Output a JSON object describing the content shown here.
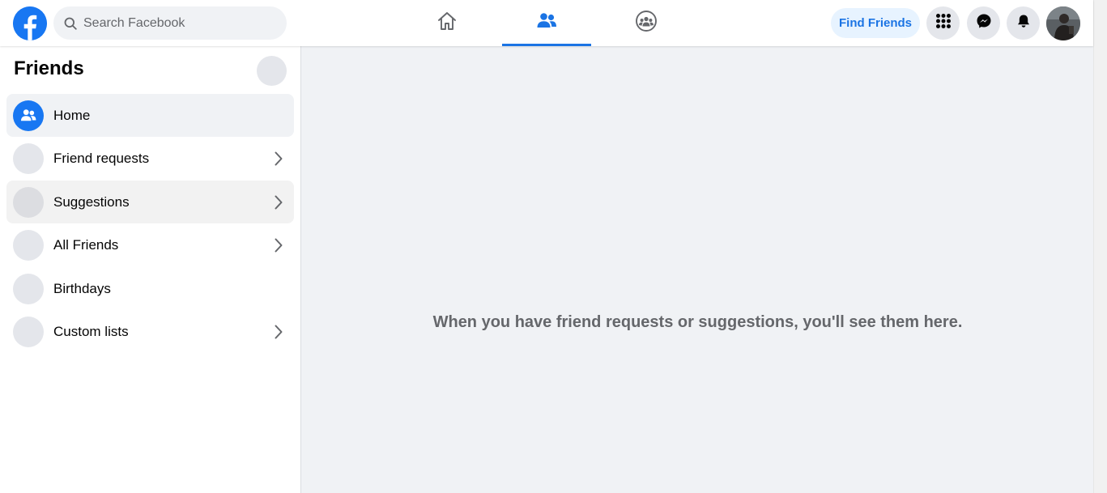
{
  "header": {
    "logo_icon": "facebook-logo",
    "search": {
      "placeholder": "Search Facebook",
      "icon": "search-icon"
    },
    "tabs": [
      {
        "name": "home",
        "icon": "home-icon",
        "active": false
      },
      {
        "name": "friends",
        "icon": "friends-icon",
        "active": true
      },
      {
        "name": "groups",
        "icon": "groups-icon",
        "active": false
      }
    ],
    "find_friends_label": "Find Friends",
    "menu_icon": "grid-menu-icon",
    "messenger_icon": "messenger-icon",
    "notifications_icon": "bell-icon"
  },
  "sidebar": {
    "title": "Friends",
    "items": [
      {
        "label": "Home",
        "icon": "friends-icon",
        "active": true,
        "chevron": false
      },
      {
        "label": "Friend requests",
        "icon": "friend-requests-icon",
        "active": false,
        "chevron": true
      },
      {
        "label": "Suggestions",
        "icon": "suggestions-icon",
        "active": false,
        "chevron": true
      },
      {
        "label": "All Friends",
        "icon": "all-friends-icon",
        "active": false,
        "chevron": true
      },
      {
        "label": "Birthdays",
        "icon": "birthdays-icon",
        "active": false,
        "chevron": false
      },
      {
        "label": "Custom lists",
        "icon": "custom-lists-icon",
        "active": false,
        "chevron": true
      }
    ]
  },
  "main": {
    "empty_message": "When you have friend requests or suggestions, you'll see them here."
  },
  "colors": {
    "brand": "#1877f2",
    "accent": "#1b74e4",
    "page_bg": "#f0f2f5",
    "secondary_text": "#65676b"
  }
}
